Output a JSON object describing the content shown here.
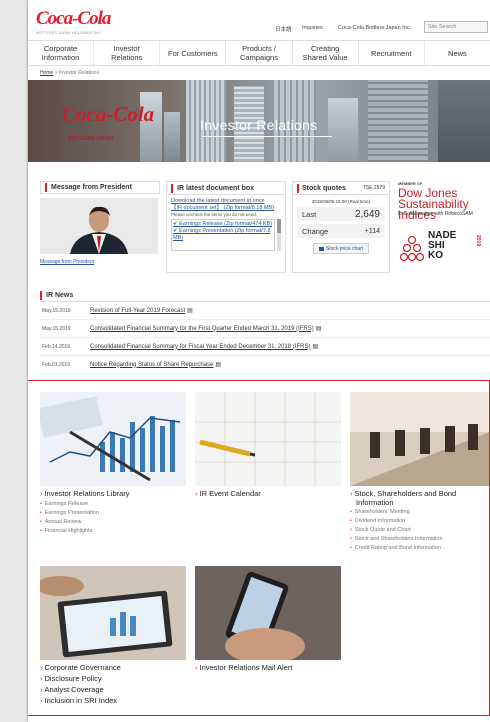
{
  "header": {
    "logo": "Coca-Cola",
    "logo_sub": "BOTTLERS JAPAN HOLDINGS INC.",
    "top_links": [
      "日本語",
      "Inquiries",
      "Coca-Cola Bottlers Japan Inc."
    ],
    "search_placeholder": "Site Search"
  },
  "nav": [
    "Corporate\nInformation",
    "Investor\nRelations",
    "For Customers",
    "Products /\nCampaigns",
    "Creating\nShared Value",
    "Recruitment",
    "News"
  ],
  "breadcrumb": {
    "home": "Home",
    "sep": ">",
    "current": "Investor Relations"
  },
  "hero": {
    "logo": "Coca-Cola",
    "logo_sub": "BOTTLERS JAPAN",
    "title": "Investor Relations"
  },
  "president_box": {
    "title": "Message from President",
    "link": "Message from President"
  },
  "documents_box": {
    "title": "IR latest document box",
    "download_link": "Download the latest document at once",
    "file_info": "【IR document set】 (Zip format/8.18 MB)",
    "note": "Please uncheck the items you do not need.",
    "items": [
      "Earnings Release (Zip format/474 KB)",
      "Earnings Presentation (Zip format/7.8 MB)"
    ]
  },
  "stock_box": {
    "title": "Stock quotes",
    "ticker": "TSE:2579",
    "datetime": "2019/06/05 15:00 (Real time)",
    "last_label": "Last",
    "last_value": "2,649",
    "change_label": "Change",
    "change_value": "+114",
    "chart_button": "Stock price chart"
  },
  "dow_jones": {
    "member_of": "MEMBER OF",
    "name": "Dow Jones Sustainability Indices",
    "collab": "In Collaboration with RobecoSAM"
  },
  "nadeshiko": {
    "line1": "NADE",
    "line2": "SHI",
    "line3": "KO",
    "year": "2019"
  },
  "ir_news": {
    "title": "IR News",
    "items": [
      {
        "date": "May.15.2019",
        "title": "Revision of Full-Year 2019 Forecast"
      },
      {
        "date": "May.15.2019",
        "title": "Consolidated Financial Summary for the First Quarter Ended March 31, 2019 (IFRS)"
      },
      {
        "date": "Feb.14.2019",
        "title": "Consolidated Financial Summary for Fiscal Year Ended December 31, 2018 (IFRS)"
      },
      {
        "date": "Feb.01.2019",
        "title": "Notice Regarding Status of Share Repurchase"
      }
    ]
  },
  "tiles": {
    "library": {
      "title": "Investor Relations Library",
      "items": [
        "Earnings Release",
        "Earnings Presentation",
        "Annual Review",
        "Financial Highlights"
      ]
    },
    "calendar": {
      "title": "IR Event Calendar"
    },
    "stock": {
      "title_line1": "Stock, Shareholders and Bond",
      "title_line2": "Information",
      "items": [
        "Shareholders' Meeting",
        "Dividend Information",
        "Stock Quote and Chart",
        "Stock and Shareholders Information",
        "Credit Rating and Bond Information"
      ]
    },
    "governance": {
      "title": "Corporate Governance",
      "items": [
        "Disclosure Policy",
        "Analyst Coverage",
        "Inclusion in SRI Index"
      ]
    },
    "mail_alert": {
      "title": "Investor Relations Mail Alert"
    }
  }
}
